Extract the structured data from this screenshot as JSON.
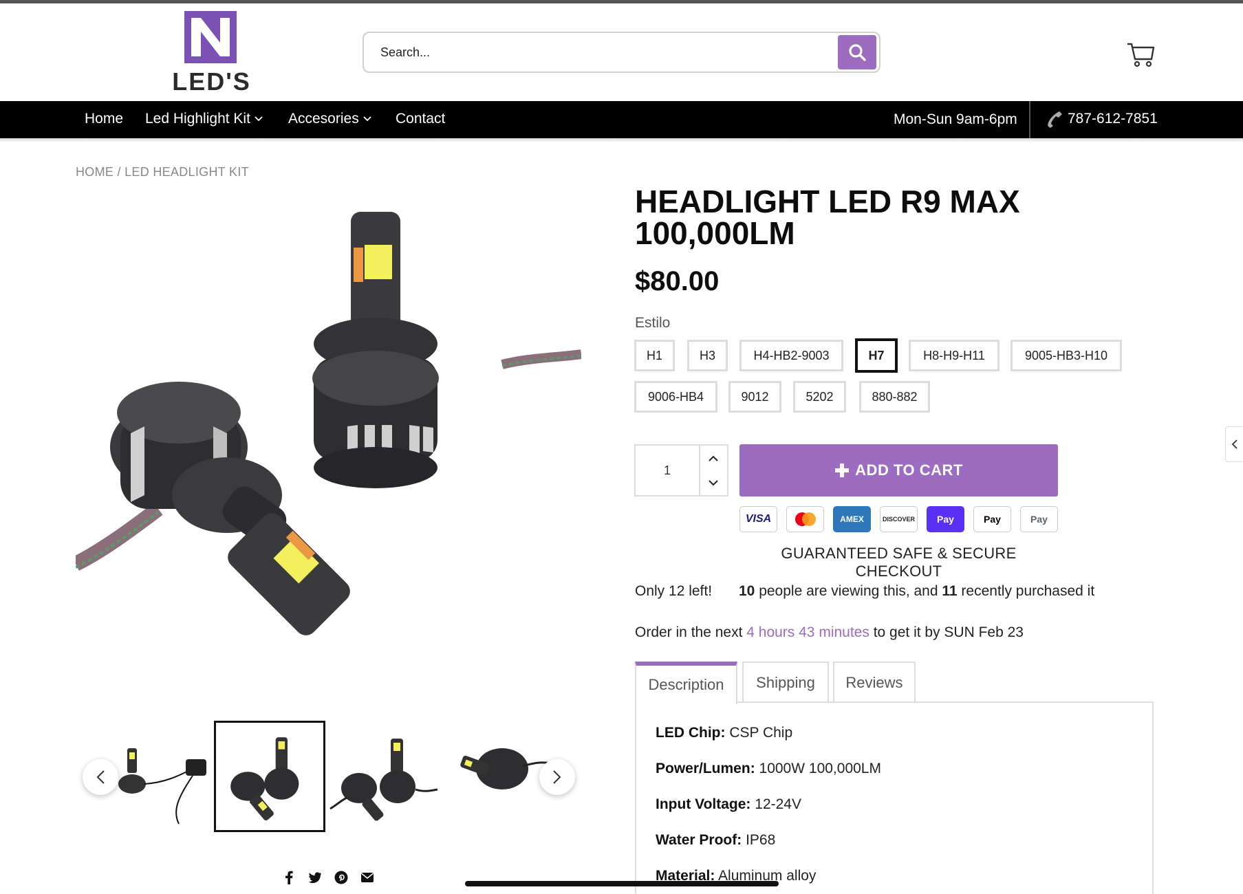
{
  "header": {
    "logo_text": "LED'S",
    "logo_letter": "N",
    "search_placeholder": "Search...",
    "icons": [
      "search-icon",
      "cart-icon"
    ]
  },
  "nav": {
    "items": [
      {
        "label": "Home",
        "dropdown": false
      },
      {
        "label": "Led Highlight Kit",
        "dropdown": true
      },
      {
        "label": "Accesories",
        "dropdown": true
      },
      {
        "label": "Contact",
        "dropdown": false
      }
    ],
    "hours": "Mon-Sun 9am-6pm",
    "phone": "787-612-7851"
  },
  "breadcrumb": "HOME / LED HEADLIGHT KIT",
  "product": {
    "title": "HEADLIGHT LED R9 MAX 100,000LM",
    "price": "$80.00",
    "option_label": "Estilo",
    "options": [
      "H1",
      "H3",
      "H4-HB2-9003",
      "H7",
      "H8-H9-H11",
      "9005-HB3-H10",
      "9006-HB4",
      "9012",
      "5202",
      "880-882"
    ],
    "selected_option": "H7",
    "quantity": "1",
    "add_to_cart": "ADD TO CART",
    "payments": [
      "VISA",
      "Mastercard",
      "AMEX",
      "DISCOVER",
      "Pay",
      "Pay",
      "Pay"
    ],
    "secure_text": "GUARANTEED SAFE & SECURE CHECKOUT",
    "stock_text": "Only 12 left!",
    "viewing": {
      "count": "10",
      "middle": " people are viewing this, and ",
      "purchased": "11",
      "end": " recently purchased it"
    },
    "order": {
      "prefix": "Order in the next ",
      "countdown": "4 hours 43 minutes",
      "suffix": " to get it by SUN Feb 23"
    }
  },
  "tabs": [
    "Description",
    "Shipping",
    "Reviews"
  ],
  "active_tab": "Description",
  "specs": [
    {
      "key": "LED Chip:",
      "value": " CSP Chip"
    },
    {
      "key": "Power/Lumen:",
      "value": " 1000W 100,000LM"
    },
    {
      "key": "Input Voltage:",
      "value": " 12-24V"
    },
    {
      "key": "Water Proof:",
      "value": " IP68"
    },
    {
      "key": "Material:",
      "value": " Aluminum alloy"
    }
  ],
  "colors": {
    "accent": "#9b6cc0",
    "nav_bg": "#000000",
    "border": "#dddddd"
  }
}
